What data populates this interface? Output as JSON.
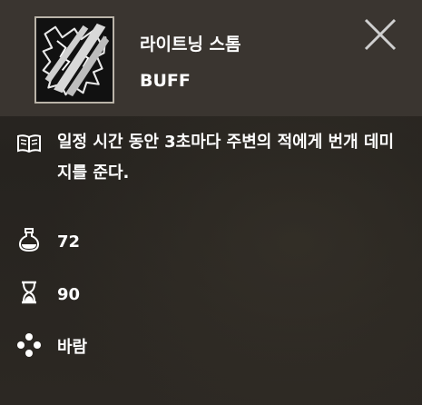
{
  "skill": {
    "name": "라이트닝 스톰",
    "type": "BUFF",
    "icon": "lightning-storm-icon"
  },
  "description": "일정 시간 동안 3초마다 주변의 적에게 번개 데미지를 준다.",
  "stats": {
    "cost": "72",
    "cooldown": "90",
    "element": "바람"
  },
  "icons": {
    "description": "book-icon",
    "cost": "potion-flask-icon",
    "cooldown": "hourglass-icon",
    "element": "wind-dots-icon",
    "close": "close-icon"
  },
  "colors": {
    "header_bg": "#3a3530",
    "body_bg": "#2b2722",
    "text": "#ffffff",
    "close": "#cfcfcf"
  }
}
